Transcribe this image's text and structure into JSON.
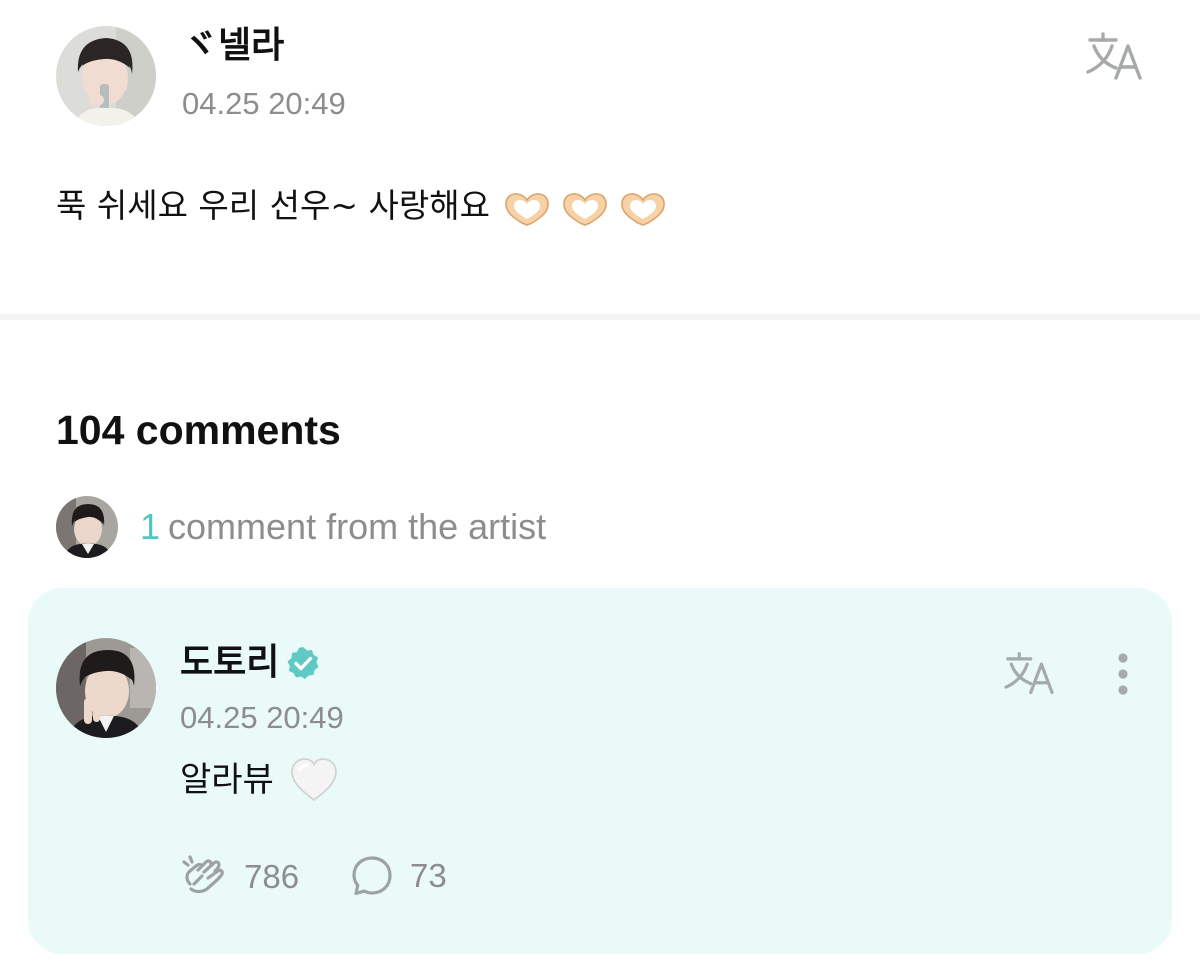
{
  "post": {
    "author": "ヾ넬라",
    "timestamp": "04.25 20:49",
    "body": "푹 쉬세요 우리 선우~ 사랑해요",
    "emoji": "heart-hands-emoji"
  },
  "comments_section": {
    "count_label": "104 comments",
    "artist_comment_count": "1",
    "artist_comment_label": "comment from the artist"
  },
  "artist_comment": {
    "author": "도토리",
    "verified": true,
    "timestamp": "04.25 20:49",
    "text": "알라뷰",
    "emoji": "white-heart-emoji",
    "likes": "786",
    "replies": "73"
  },
  "icons": {
    "translate": "translate-icon",
    "more": "more-vertical-icon",
    "like": "cheer-hand-icon",
    "reply": "speech-bubble-icon",
    "verified": "verified-badge-icon"
  },
  "colors": {
    "accent": "#4cc8c2",
    "card_background": "#e9faf8",
    "muted_text": "#8d8d8d",
    "icon_gray": "#a6aaa9",
    "divider": "#f3f3f3"
  }
}
